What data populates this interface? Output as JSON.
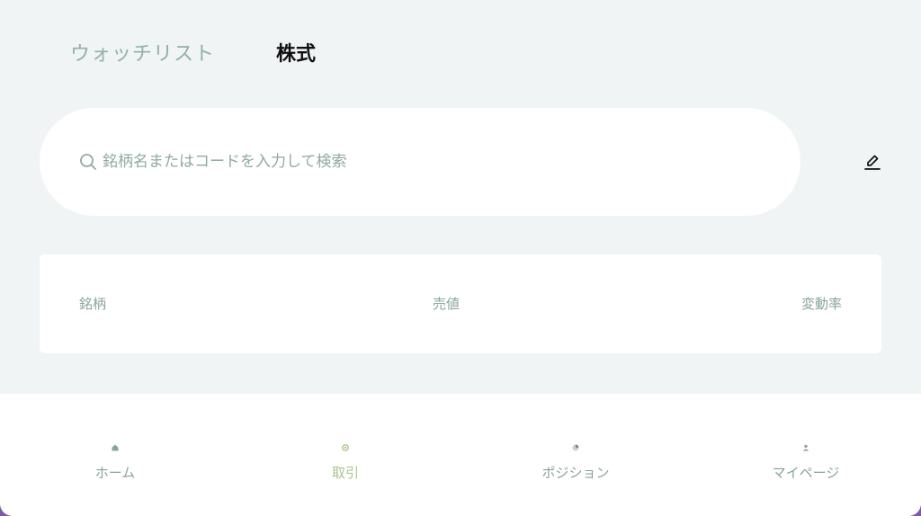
{
  "tabs": [
    {
      "label": "ウォッチリスト",
      "active": false
    },
    {
      "label": "株式",
      "active": true
    }
  ],
  "search": {
    "placeholder": "銘柄名またはコードを入力して検索",
    "value": ""
  },
  "table": {
    "headers": [
      "銘柄",
      "売値",
      "変動率"
    ]
  },
  "bottom_nav": {
    "items": [
      {
        "label": "ホーム",
        "icon": "home-icon",
        "active": false
      },
      {
        "label": "取引",
        "icon": "trade-icon",
        "active": true
      },
      {
        "label": "ポジション",
        "icon": "pie-chart-icon",
        "active": false
      },
      {
        "label": "マイページ",
        "icon": "user-icon",
        "active": false
      }
    ]
  },
  "colors": {
    "background": "#f0f4f4",
    "muted_text": "#8aa39f",
    "active_nav": "#a9c48a",
    "primary_text": "#111111"
  }
}
